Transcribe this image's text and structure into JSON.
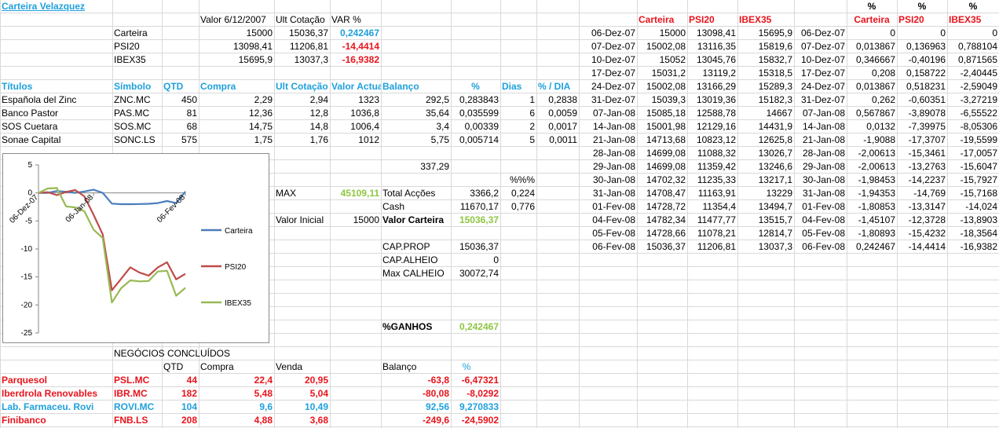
{
  "title": "Carteira Velazquez",
  "summary": {
    "headers": [
      "Valor 6/12/2007",
      "Ult Cotação",
      "VAR %"
    ],
    "rows": [
      {
        "label": "Carteira",
        "valor": "15000",
        "ult": "15036,37",
        "var": "0,242467",
        "var_color": "#1fa0dc"
      },
      {
        "label": "PSI20",
        "valor": "13098,41",
        "ult": "11206,81",
        "var": "-14,4414",
        "var_color": "#e8141c"
      },
      {
        "label": "IBEX35",
        "valor": "15695,9",
        "ult": "13037,3",
        "var": "-16,9382",
        "var_color": "#e8141c"
      }
    ]
  },
  "holdings": {
    "headers": [
      "Títulos",
      "Símbolo",
      "QTD",
      "Compra",
      "Ult Cotação",
      "Valor Actual",
      "Balanço",
      "%",
      "Dias",
      "% / DIA"
    ],
    "rows": [
      [
        "Española del Zinc",
        "ZNC.MC",
        "450",
        "2,29",
        "2,94",
        "1323",
        "292,5",
        "0,283843",
        "1",
        "0,2838"
      ],
      [
        "Banco Pastor",
        "PAS.MC",
        "81",
        "12,36",
        "12,8",
        "1036,8",
        "35,64",
        "0,035599",
        "6",
        "0,0059"
      ],
      [
        "SOS Cuetara",
        "SOS.MC",
        "68",
        "14,75",
        "14,8",
        "1006,4",
        "3,4",
        "0,00339",
        "2",
        "0,0017"
      ],
      [
        "Sonae Capital",
        "SONC.LS",
        "575",
        "1,75",
        "1,76",
        "1012",
        "5,75",
        "0,005714",
        "5",
        "0,0011"
      ]
    ],
    "balanco_total": "337,29"
  },
  "stats": {
    "pct_header": "%%%",
    "max_label": "MAX",
    "max_value": "45109,11",
    "valor_inicial_label": "Valor Inicial",
    "valor_inicial": "15000",
    "total_accoes_label": "Total Acções",
    "total_accoes": "3366,2",
    "total_accoes_pct": "0,224",
    "cash_label": "Cash",
    "cash": "11670,17",
    "cash_pct": "0,776",
    "valor_carteira_label": "Valor Carteira",
    "valor_carteira": "15036,37",
    "cap_prop_label": "CAP.PROP",
    "cap_prop": "15036,37",
    "cap_alheio_label": "CAP.ALHEIO",
    "cap_alheio": "0",
    "max_calheio_label": "Max CALHEIO",
    "max_calheio": "30072,74",
    "ganhos_label": "%GANHOS",
    "ganhos": "0,242467"
  },
  "closed": {
    "title": "NEGÓCIOS CONCLUÍDOS",
    "headers": [
      "QTD",
      "Compra",
      "Venda",
      "Balanço",
      "%"
    ],
    "rows": [
      {
        "name": "Parquesol",
        "sym": "PSL.MC",
        "qtd": "44",
        "compra": "22,4",
        "venda": "20,95",
        "bal": "-63,8",
        "pct": "-6,47321",
        "color": "#e8141c"
      },
      {
        "name": "Iberdrola Renovables",
        "sym": "IBR.MC",
        "qtd": "182",
        "compra": "5,48",
        "venda": "5,04",
        "bal": "-80,08",
        "pct": "-8,0292",
        "color": "#e8141c"
      },
      {
        "name": "Lab. Farmaceu. Rovi",
        "sym": "ROVI.MC",
        "qtd": "104",
        "compra": "9,6",
        "venda": "10,49",
        "bal": "92,56",
        "pct": "9,270833",
        "color": "#1fa0dc"
      },
      {
        "name": "Finibanco",
        "sym": "FNB.LS",
        "qtd": "208",
        "compra": "4,88",
        "venda": "3,68",
        "bal": "-249,6",
        "pct": "-24,5902",
        "color": "#e8141c"
      }
    ]
  },
  "history": {
    "headers": [
      "Carteira",
      "PSI20",
      "IBEX35"
    ],
    "pct_headers": [
      "Carteira",
      "PSI20",
      "IBEX35"
    ],
    "pct_mark": "%",
    "rows": [
      [
        "06-Dez-07",
        "15000",
        "13098,41",
        "15695,9",
        "06-Dez-07",
        "0",
        "0",
        "0"
      ],
      [
        "07-Dez-07",
        "15002,08",
        "13116,35",
        "15819,6",
        "07-Dez-07",
        "0,013867",
        "0,136963",
        "0,788104"
      ],
      [
        "10-Dez-07",
        "15052",
        "13045,76",
        "15832,7",
        "10-Dez-07",
        "0,346667",
        "-0,40196",
        "0,871565"
      ],
      [
        "17-Dez-07",
        "15031,2",
        "13119,2",
        "15318,5",
        "17-Dez-07",
        "0,208",
        "0,158722",
        "-2,40445"
      ],
      [
        "24-Dez-07",
        "15002,08",
        "13166,29",
        "15289,3",
        "24-Dez-07",
        "0,013867",
        "0,518231",
        "-2,59049"
      ],
      [
        "31-Dez-07",
        "15039,3",
        "13019,36",
        "15182,3",
        "31-Dez-07",
        "0,262",
        "-0,60351",
        "-3,27219"
      ],
      [
        "07-Jan-08",
        "15085,18",
        "12588,78",
        "14667",
        "07-Jan-08",
        "0,567867",
        "-3,89078",
        "-6,55522"
      ],
      [
        "14-Jan-08",
        "15001,98",
        "12129,16",
        "14431,9",
        "14-Jan-08",
        "0,0132",
        "-7,39975",
        "-8,05306"
      ],
      [
        "21-Jan-08",
        "14713,68",
        "10823,12",
        "12625,8",
        "21-Jan-08",
        "-1,9088",
        "-17,3707",
        "-19,5599"
      ],
      [
        "28-Jan-08",
        "14699,08",
        "11088,32",
        "13026,7",
        "28-Jan-08",
        "-2,00613",
        "-15,3461",
        "-17,0057"
      ],
      [
        "29-Jan-08",
        "14699,08",
        "11359,42",
        "13246,6",
        "29-Jan-08",
        "-2,00613",
        "-13,2763",
        "-15,6047"
      ],
      [
        "30-Jan-08",
        "14702,32",
        "11235,33",
        "13217,1",
        "30-Jan-08",
        "-1,98453",
        "-14,2237",
        "-15,7927"
      ],
      [
        "31-Jan-08",
        "14708,47",
        "11163,91",
        "13229",
        "31-Jan-08",
        "-1,94353",
        "-14,769",
        "-15,7168"
      ],
      [
        "01-Fev-08",
        "14728,72",
        "11354,4",
        "13494,7",
        "01-Fev-08",
        "-1,80853",
        "-13,3147",
        "-14,024"
      ],
      [
        "04-Fev-08",
        "14782,34",
        "11477,77",
        "13515,7",
        "04-Fev-08",
        "-1,45107",
        "-12,3728",
        "-13,8903"
      ],
      [
        "05-Fev-08",
        "14728,66",
        "11078,21",
        "12814,7",
        "05-Fev-08",
        "-1,80893",
        "-15,4232",
        "-18,3564"
      ],
      [
        "06-Fev-08",
        "15036,37",
        "11206,81",
        "13037,3",
        "06-Fev-08",
        "0,242467",
        "-14,4414",
        "-16,9382"
      ]
    ]
  },
  "colors": {
    "blue": "#1fa0dc",
    "red": "#e8141c",
    "green": "#8ec641",
    "carteira_line": "#4a7ebb",
    "psi_line": "#be4b48",
    "ibex_line": "#98b954"
  },
  "chart_data": {
    "type": "line",
    "x": [
      "06-Dez-07",
      "07-Dez-07",
      "10-Dez-07",
      "17-Dez-07",
      "24-Dez-07",
      "31-Dez-07",
      "07-Jan-08",
      "14-Jan-08",
      "21-Jan-08",
      "28-Jan-08",
      "29-Jan-08",
      "30-Jan-08",
      "31-Jan-08",
      "01-Fev-08",
      "04-Fev-08",
      "05-Fev-08",
      "06-Fev-08"
    ],
    "series": [
      {
        "name": "Carteira",
        "color": "#4a7ebb",
        "values": [
          0,
          0.013867,
          0.346667,
          0.208,
          0.013867,
          0.262,
          0.567867,
          0.0132,
          -1.9088,
          -2.00613,
          -2.00613,
          -1.98453,
          -1.94353,
          -1.80853,
          -1.45107,
          -1.80893,
          0.242467
        ]
      },
      {
        "name": "PSI20",
        "color": "#be4b48",
        "values": [
          0,
          0.136963,
          -0.40196,
          0.158722,
          0.518231,
          -0.60351,
          -3.89078,
          -7.39975,
          -17.3707,
          -15.3461,
          -13.2763,
          -14.2237,
          -14.769,
          -13.3147,
          -12.3728,
          -15.4232,
          -14.4414
        ]
      },
      {
        "name": "IBEX35",
        "color": "#98b954",
        "values": [
          0,
          0.788104,
          0.871565,
          -2.40445,
          -2.59049,
          -3.27219,
          -6.55522,
          -8.05306,
          -19.5599,
          -17.0057,
          -15.6047,
          -15.7927,
          -15.7168,
          -14.024,
          -13.8903,
          -18.3564,
          -16.9382
        ]
      }
    ],
    "yticks": [
      "5",
      "0",
      "-5",
      "-10",
      "-15",
      "-20",
      "-25"
    ],
    "ytick_values": [
      5,
      0,
      -5,
      -10,
      -15,
      -20,
      -25
    ],
    "xticks": [
      "06-Dez-07",
      "06-Jan-08",
      "06-Fev-08"
    ],
    "ylim": [
      -25,
      5
    ],
    "grid": false,
    "legend": "right",
    "title": "",
    "xlabel": "",
    "ylabel": ""
  }
}
